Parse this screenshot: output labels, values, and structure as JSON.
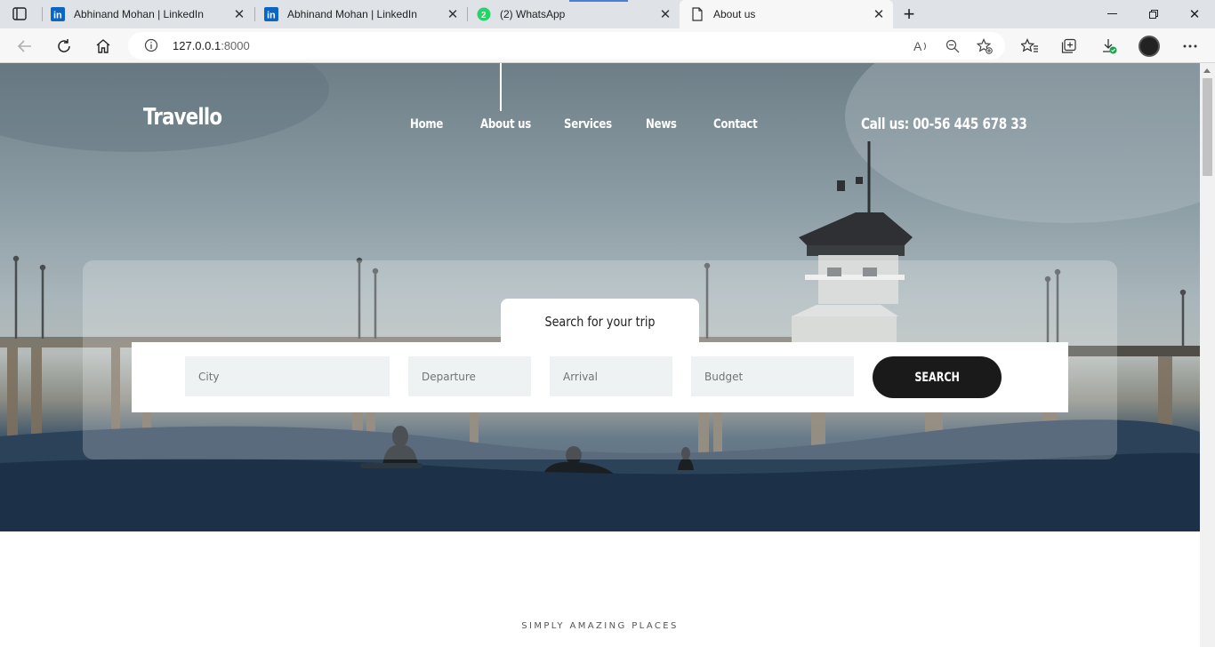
{
  "browser": {
    "tabs": [
      {
        "title": "Abhinand Mohan | LinkedIn",
        "icon": "linkedin-icon"
      },
      {
        "title": "Abhinand Mohan | LinkedIn",
        "icon": "linkedin-icon"
      },
      {
        "title": "(2) WhatsApp",
        "icon": "whatsapp-icon",
        "badge": "2"
      },
      {
        "title": "About us",
        "icon": "page-icon",
        "active": true
      }
    ],
    "url_host": "127.0.0.1",
    "url_port": ":8000"
  },
  "site": {
    "brand": "Travello",
    "nav": [
      "Home",
      "About us",
      "Services",
      "News",
      "Contact"
    ],
    "call": "Call us: 00-56 445 678 33"
  },
  "search": {
    "tab_label": "Search for your trip",
    "city_placeholder": "City",
    "departure_placeholder": "Departure",
    "arrival_placeholder": "Arrival",
    "budget_placeholder": "Budget",
    "button_label": "SEARCH"
  },
  "section": {
    "tagline": "SIMPLY AMAZING PLACES"
  },
  "colors": {
    "accent_dark": "#1a1a1a",
    "field_bg": "#eff2f3",
    "linkedin": "#0a66c2",
    "whatsapp": "#25d366"
  }
}
